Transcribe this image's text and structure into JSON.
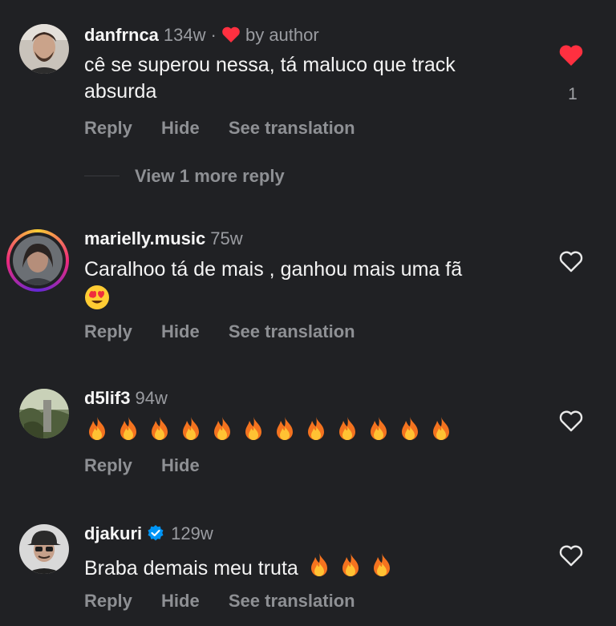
{
  "comments": [
    {
      "username": "danfrnca",
      "time": "134w",
      "author_badge": "by author",
      "text": "cê se superou nessa, tá maluco que track absurda",
      "actions": {
        "reply": "Reply",
        "hide": "Hide",
        "see_translation": "See translation"
      },
      "liked": true,
      "like_count": "1",
      "view_more": "View 1 more reply"
    },
    {
      "username": "marielly.music",
      "time": "75w",
      "text": "Caralhoo tá de mais , ganhou mais uma fã",
      "emoji": "smiling-face-with-heart-eyes",
      "actions": {
        "reply": "Reply",
        "hide": "Hide",
        "see_translation": "See translation"
      },
      "liked": false
    },
    {
      "username": "d5lif3",
      "time": "94w",
      "emoji_count": 12,
      "emoji": "fire",
      "actions": {
        "reply": "Reply",
        "hide": "Hide"
      },
      "liked": false
    },
    {
      "username": "djakuri",
      "time": "129w",
      "verified": true,
      "text": "Braba demais meu truta",
      "emoji": "fire",
      "emoji_count": 3,
      "actions": {
        "reply": "Reply",
        "hide": "Hide",
        "see_translation": "See translation"
      },
      "liked": false
    }
  ],
  "colors": {
    "background": "#202124",
    "like_red": "#ff3040",
    "verified_blue": "#0095f6",
    "muted_text": "#8e9094"
  }
}
